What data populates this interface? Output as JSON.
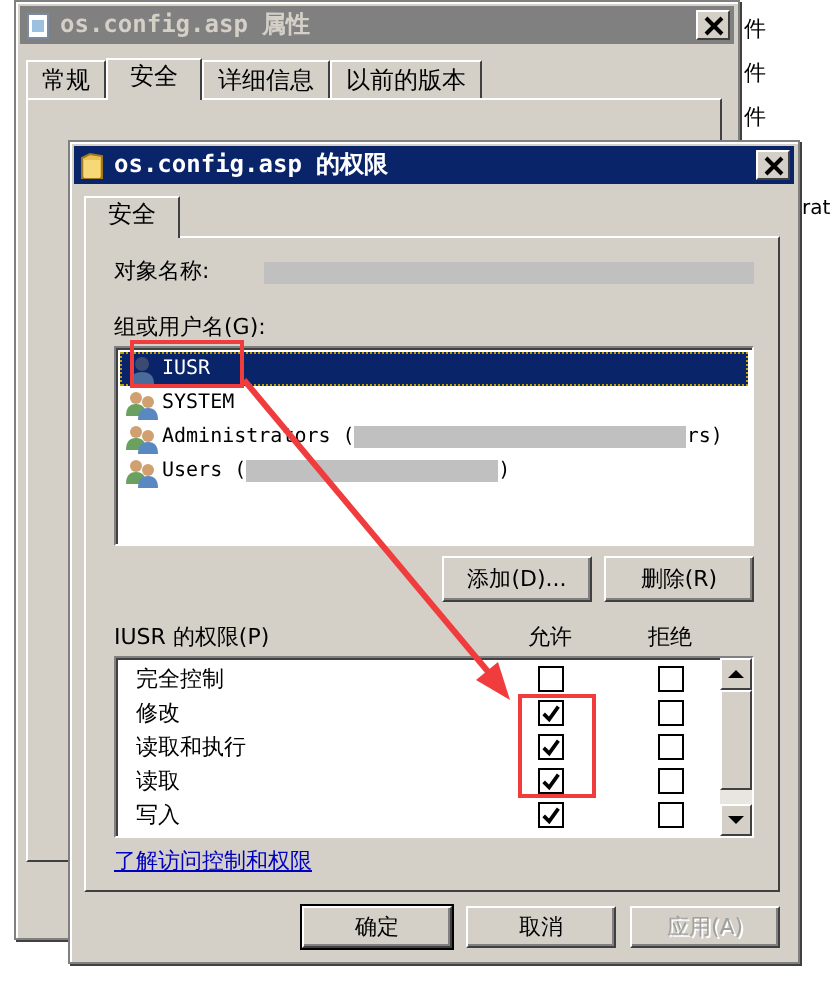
{
  "background_text": [
    "件",
    "件",
    "件",
    "rat"
  ],
  "back_window": {
    "title": "os.config.asp 属性",
    "tabs": [
      {
        "label": "常规",
        "selected": false
      },
      {
        "label": "安全",
        "selected": true
      },
      {
        "label": "详细信息",
        "selected": false
      },
      {
        "label": "以前的版本",
        "selected": false
      }
    ]
  },
  "window": {
    "title": "os.config.asp 的权限",
    "tabs": [
      {
        "label": "安全",
        "selected": true
      }
    ],
    "object_name_label": "对象名称:",
    "object_name_redacted": true,
    "users_label": "组或用户名(G):",
    "users": [
      {
        "kind": "user",
        "label": "IUSR",
        "selected": true
      },
      {
        "kind": "group",
        "label": "SYSTEM",
        "selected": false
      },
      {
        "kind": "group",
        "label": "Administrators (",
        "redacted": true,
        "suffix": "rs)",
        "selected": false
      },
      {
        "kind": "group",
        "label": "Users (",
        "redacted": true,
        "suffix": ")",
        "selected": false
      }
    ],
    "user_buttons": [
      "添加(D)...",
      "删除(R)"
    ],
    "permissions_label": "IUSR 的权限(P)",
    "allow_header": "允许",
    "deny_header": "拒绝",
    "permissions": [
      {
        "label": "完全控制",
        "allow": false,
        "deny": false
      },
      {
        "label": "修改",
        "allow": true,
        "deny": false
      },
      {
        "label": "读取和执行",
        "allow": true,
        "deny": false
      },
      {
        "label": "读取",
        "allow": true,
        "deny": false
      },
      {
        "label": "写入",
        "allow": true,
        "deny": false
      }
    ],
    "link": "了解访问控制和权限",
    "buttons": [
      {
        "label": "确定",
        "disabled": false,
        "default": true
      },
      {
        "label": "取消",
        "disabled": false,
        "default": false
      },
      {
        "label": "应用(A)",
        "disabled": true,
        "default": false
      }
    ]
  },
  "annotations": [
    {
      "kind": "box"
    },
    {
      "kind": "arrow"
    },
    {
      "kind": "box"
    }
  ]
}
